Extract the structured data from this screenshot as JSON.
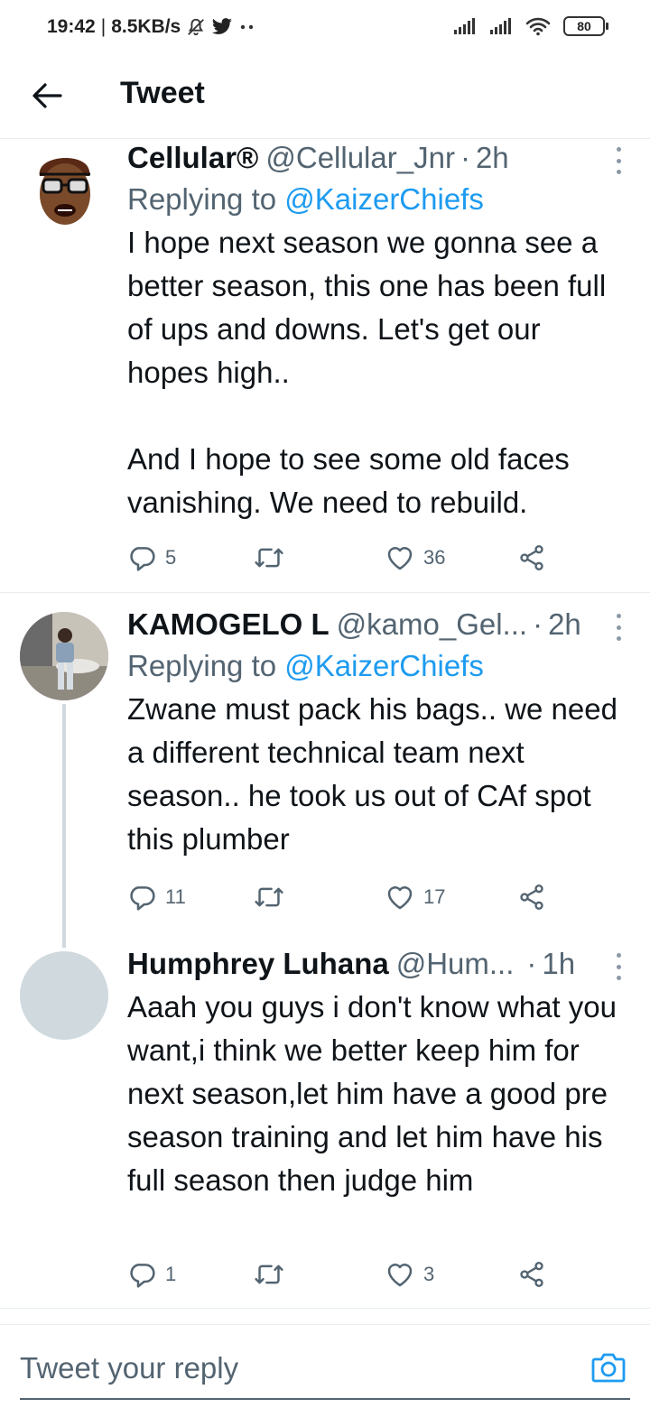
{
  "status_bar": {
    "time": "19:42",
    "speed": "8.5KB/s",
    "battery": "80",
    "icons": [
      "mute-icon",
      "twitter-bird-icon",
      "more-dots-icon",
      "signal-icon",
      "signal-icon",
      "wifi-icon",
      "battery-icon"
    ]
  },
  "header": {
    "title": "Tweet",
    "back_icon": "arrow-left-icon"
  },
  "tweets": [
    {
      "name": "Cellular®",
      "handle": "@Cellular_Jnr",
      "dot": "·",
      "time": "2h",
      "replying_prefix": "Replying to ",
      "replying_to": "@KaizerChiefs",
      "text": "I hope next season we gonna see a better season, this one has been full of ups and downs. Let's get our hopes high..\n\nAnd I hope to see some old faces vanishing. We need to rebuild.",
      "replies": "5",
      "retweets": "",
      "likes": "36"
    },
    {
      "name": "KAMOGELO L",
      "handle": "@kamo_Gel...",
      "dot": "·",
      "time": "2h",
      "replying_prefix": "Replying to ",
      "replying_to": "@KaizerChiefs",
      "text": "Zwane must pack his bags.. we need a different technical team next season.. he took us out of CAf spot this plumber",
      "replies": "11",
      "retweets": "",
      "likes": "17"
    },
    {
      "name": "Humphrey Luhana",
      "handle": "@Hum...",
      "dot": "·",
      "time": "1h",
      "text": "Aaah you guys i don't know what you want,i think we better keep him for next season,let him have a good pre season training and let him have his full season then judge him",
      "replies": "1",
      "retweets": "",
      "likes": "3"
    }
  ],
  "reply_bar": {
    "placeholder": "Tweet your reply",
    "camera_icon": "camera-icon"
  },
  "colors": {
    "accent": "#1d9bf0",
    "secondary_text": "#536471",
    "divider": "#e6ecf0",
    "placeholder_avatar": "#cfd9de"
  }
}
